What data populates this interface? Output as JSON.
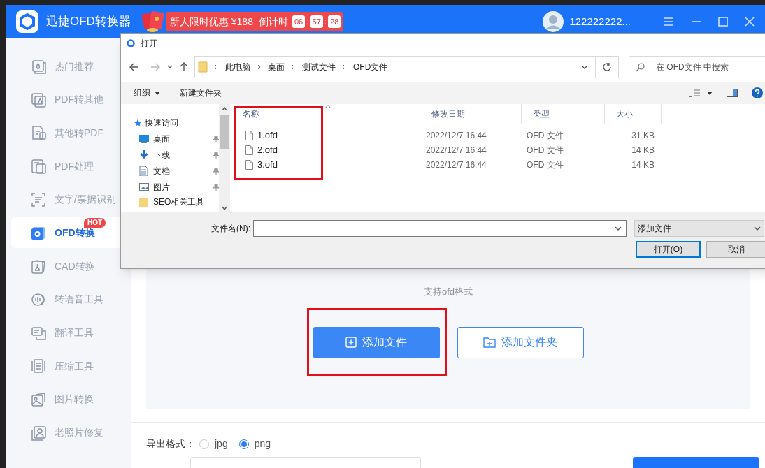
{
  "app": {
    "title": "迅捷OFD转换器",
    "promo": {
      "text": "新人限时优惠 ¥188",
      "countdown_label": "倒计时",
      "countdown": [
        "06",
        "57",
        "28"
      ],
      "countdown_separator": ":"
    },
    "user": "122222222...",
    "sidebar": [
      {
        "label": "热门推荐",
        "selected": false
      },
      {
        "label": "PDF转其他",
        "selected": false
      },
      {
        "label": "其他转PDF",
        "selected": false
      },
      {
        "label": "PDF处理",
        "selected": false
      },
      {
        "label": "文字/票据识别",
        "selected": false
      },
      {
        "label": "OFD转换",
        "selected": true,
        "badge": "HOT"
      },
      {
        "label": "CAD转换",
        "selected": false
      },
      {
        "label": "转语音工具",
        "selected": false
      },
      {
        "label": "翻译工具",
        "selected": false
      },
      {
        "label": "压缩工具",
        "selected": false
      },
      {
        "label": "图片转换",
        "selected": false
      },
      {
        "label": "老照片修复",
        "selected": false
      }
    ],
    "drop_zone": {
      "hint": "支持ofd格式",
      "buttons": [
        "添加文件",
        "添加文件夹"
      ]
    },
    "export": {
      "label": "导出格式：",
      "options": [
        {
          "label": "jpg",
          "selected": false
        },
        {
          "label": "png",
          "selected": true
        }
      ]
    }
  },
  "dialog": {
    "title": "打开",
    "breadcrumb": [
      "此电脑",
      "桌面",
      "测试文件",
      "OFD文件"
    ],
    "search": {
      "placeholder": "在 OFD文件 中搜索"
    },
    "toolbar": [
      "组织",
      "新建文件夹"
    ],
    "tree": [
      {
        "label": "快速访问",
        "children": [
          {
            "label": "桌面",
            "pinned": true
          },
          {
            "label": "下载",
            "pinned": true
          },
          {
            "label": "文档",
            "pinned": true
          },
          {
            "label": "图片",
            "pinned": true
          },
          {
            "label": "SEO相关工具",
            "pinned": false
          }
        ]
      }
    ],
    "columns": [
      "名称",
      "修改日期",
      "类型",
      "大小"
    ],
    "rows": [
      {
        "name": "1.ofd",
        "modified": "2022/12/7 16:44",
        "type": "OFD 文件",
        "size": "31 KB"
      },
      {
        "name": "2.ofd",
        "modified": "2022/12/7 16:44",
        "type": "OFD 文件",
        "size": "14 KB"
      },
      {
        "name": "3.ofd",
        "modified": "2022/12/7 16:44",
        "type": "OFD 文件",
        "size": "14 KB"
      }
    ],
    "filename_label": "文件名(N):",
    "filter": "添加文件",
    "buttons": [
      "打开(O)",
      "取消"
    ]
  }
}
